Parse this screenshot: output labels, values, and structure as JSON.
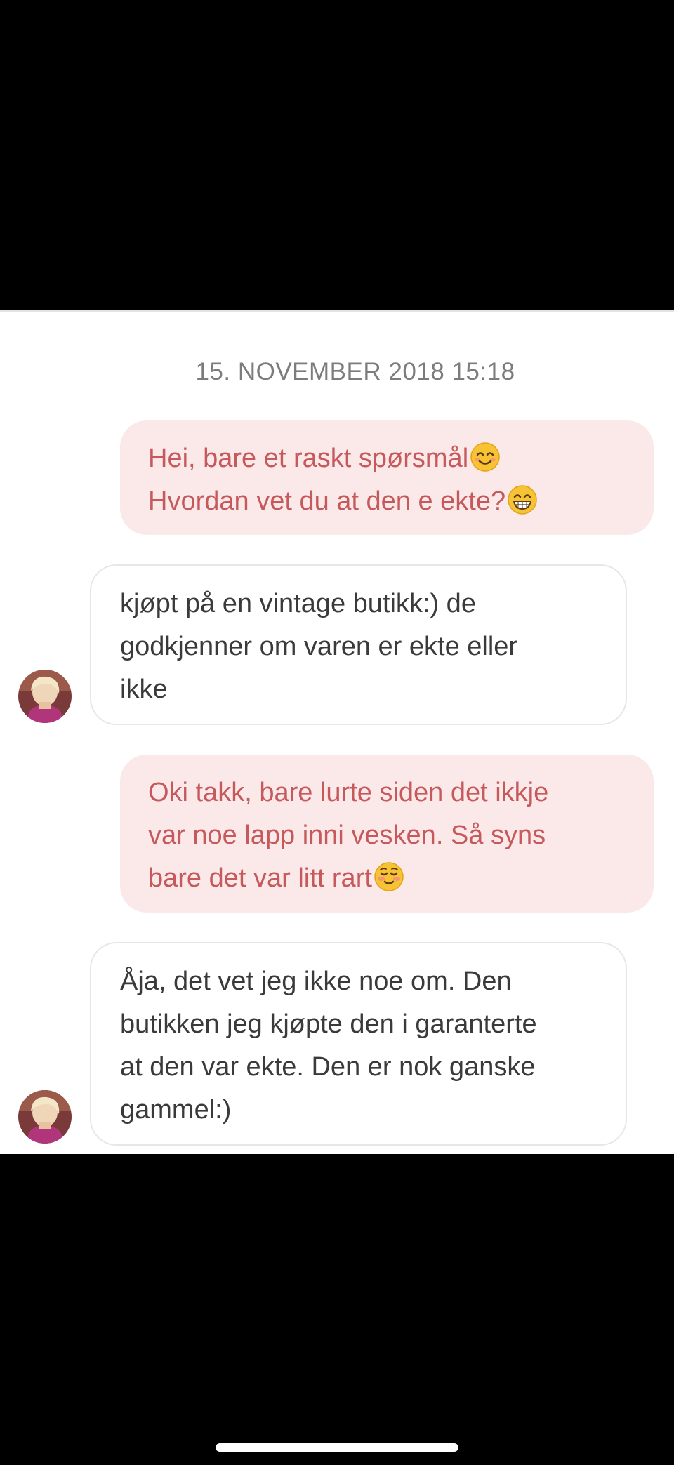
{
  "conversation": {
    "timestamp": "15. NOVEMBER 2018 15:18",
    "messages": [
      {
        "direction": "outgoing",
        "lines": [
          "Hei, bare et raskt spørsmål",
          "Hvordan vet du at den e ekte?"
        ],
        "emojis": [
          "smiling-face-emoji",
          "grinning-face-emoji"
        ]
      },
      {
        "direction": "incoming",
        "lines": [
          "kjøpt på en vintage butikk:) de",
          "godkjenner om varen er ekte eller",
          "ikke"
        ]
      },
      {
        "direction": "outgoing",
        "lines": [
          "Oki takk, bare lurte siden det ikkje",
          "var noe lapp inni vesken. Så syns",
          "bare det var litt rart"
        ],
        "emojis": [
          "relieved-blush-face-emoji"
        ]
      },
      {
        "direction": "incoming",
        "lines": [
          "Åja, det vet jeg ikke noe om. Den",
          "butikken jeg kjøpte den i garanterte",
          "at den var ekte. Den er nok ganske",
          "gammel:)"
        ]
      }
    ]
  },
  "colors": {
    "outgoing_bubble": "#fbe9e9",
    "outgoing_text": "#c6595c",
    "incoming_text": "#3a3a3a",
    "timestamp_text": "#7c7c7c"
  }
}
